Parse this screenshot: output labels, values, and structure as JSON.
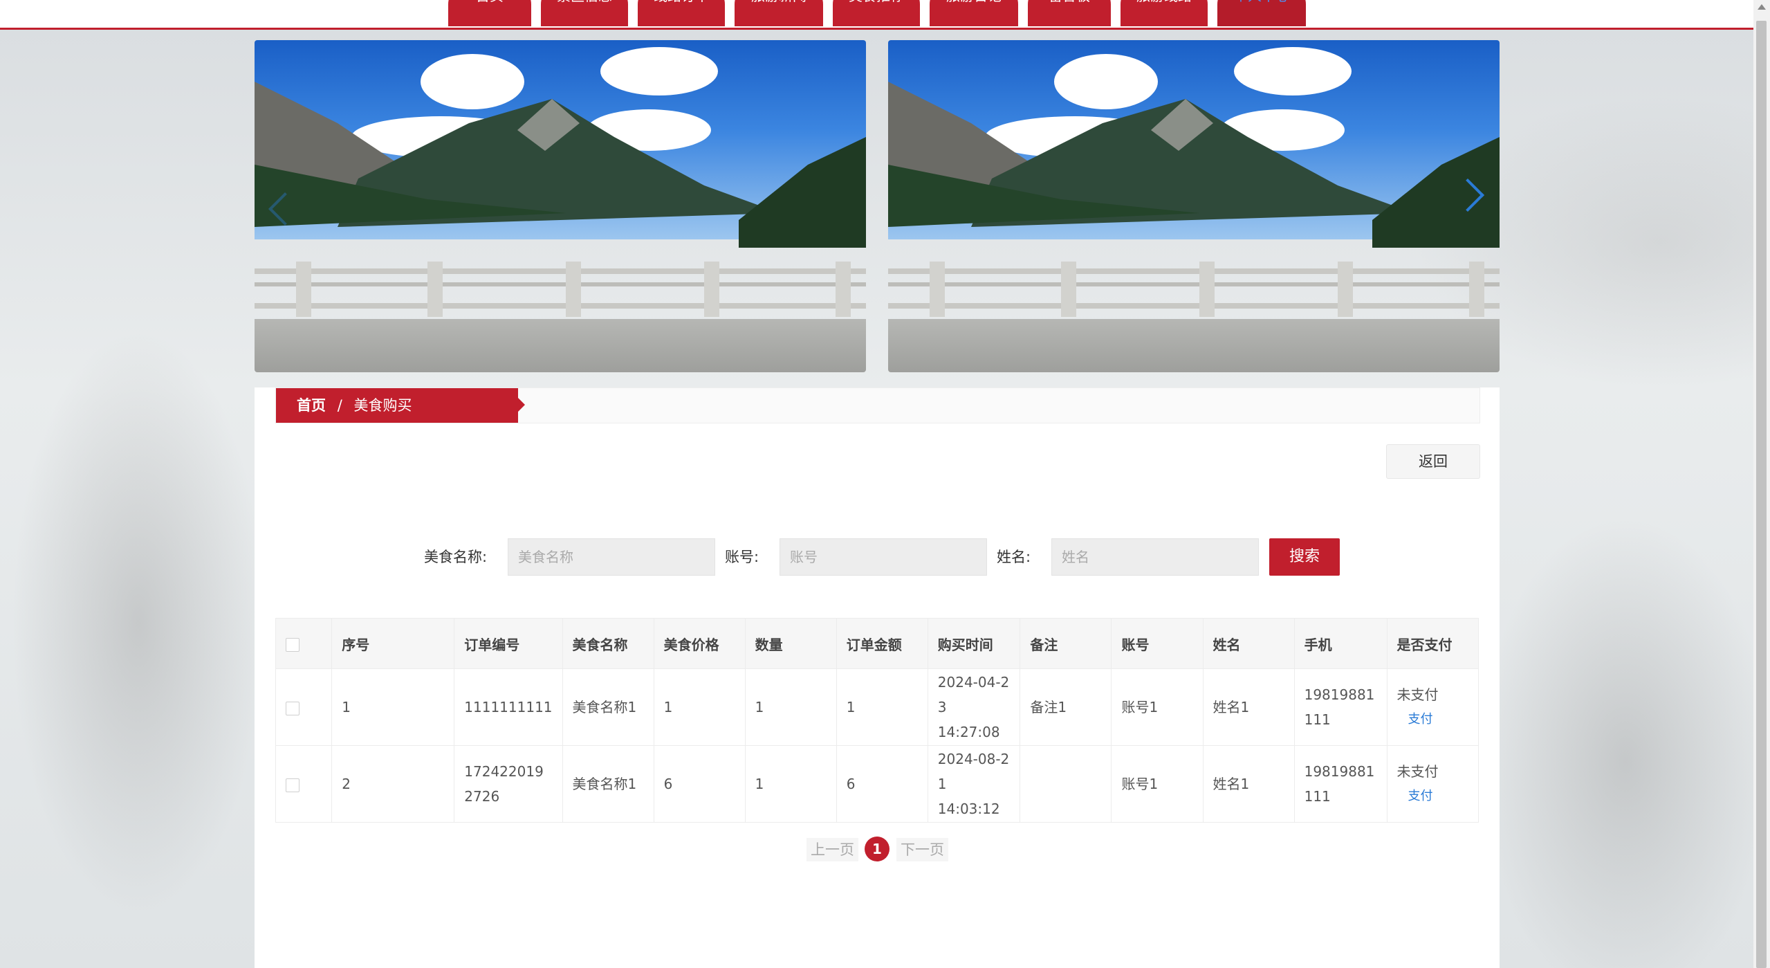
{
  "nav": {
    "items": [
      "首页",
      "景区信息",
      "线路订单",
      "旅游新闻",
      "美食推荐",
      "旅游日记",
      "留言板",
      "旅游线路",
      "个人中心"
    ],
    "active": "个人中心"
  },
  "breadcrumb": {
    "home": "首页",
    "separator": "/",
    "current": "美食购买"
  },
  "back_label": "返回",
  "search": {
    "food_name_label": "美食名称:",
    "food_name_placeholder": "美食名称",
    "account_label": "账号:",
    "account_placeholder": "账号",
    "name_label": "姓名:",
    "name_placeholder": "姓名",
    "button": "搜索"
  },
  "table": {
    "headers": [
      "序号",
      "订单编号",
      "美食名称",
      "美食价格",
      "数量",
      "订单金额",
      "购买时间",
      "备注",
      "账号",
      "姓名",
      "手机",
      "是否支付"
    ],
    "rows": [
      {
        "index": "1",
        "order_no": "1111111111",
        "food_name": "美食名称1",
        "price": "1",
        "quantity": "1",
        "amount": "1",
        "time_a": "2024-04-2",
        "time_b": "3 14:27:08",
        "remark": "备注1",
        "account": "账号1",
        "name": "姓名1",
        "phone_a": "19819881",
        "phone_b": "111",
        "paid": "未支付",
        "pay_link": "支付"
      },
      {
        "index": "2",
        "order_no_a": "172422019",
        "order_no_b": "2726",
        "food_name": "美食名称1",
        "price": "6",
        "quantity": "1",
        "amount": "6",
        "time_a": "2024-08-2",
        "time_b": "1 14:03:12",
        "remark": "",
        "account": "账号1",
        "name": "姓名1",
        "phone_a": "19819881",
        "phone_b": "111",
        "paid": "未支付",
        "pay_link": "支付"
      }
    ]
  },
  "pager": {
    "prev": "上一页",
    "current": "1",
    "next": "下一页"
  },
  "colors": {
    "brand": "#c11f2d",
    "link": "#2a7bd6"
  }
}
